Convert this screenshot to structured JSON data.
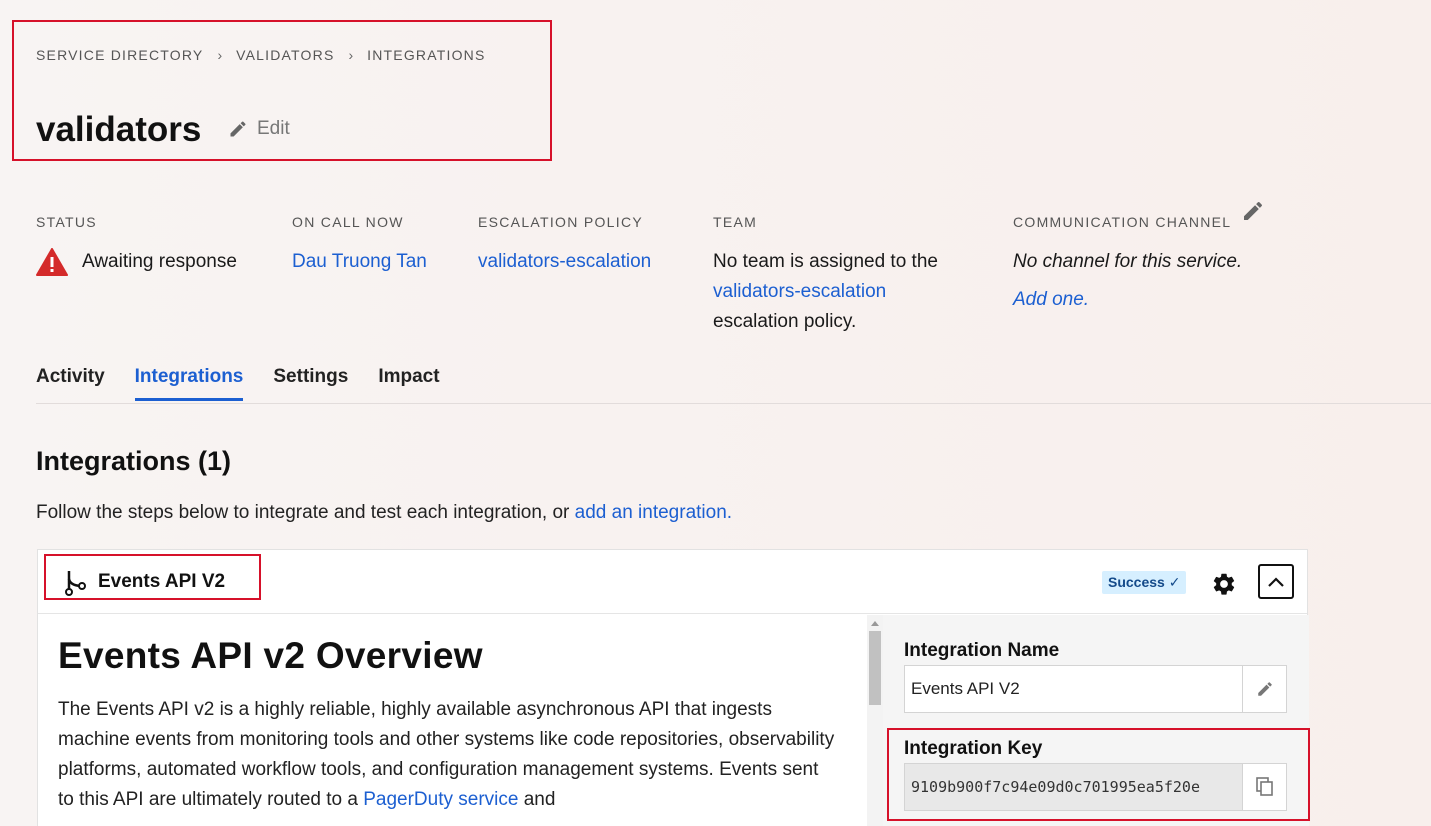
{
  "breadcrumb": {
    "items": [
      "SERVICE DIRECTORY",
      "VALIDATORS",
      "INTEGRATIONS"
    ],
    "separator": "›"
  },
  "page": {
    "title": "validators",
    "edit_label": "Edit"
  },
  "meta": {
    "status": {
      "label": "STATUS",
      "value": "Awaiting response",
      "icon": "warning-triangle-icon",
      "color": "#d42a2a"
    },
    "on_call": {
      "label": "ON CALL NOW",
      "value": "Dau Truong Tan"
    },
    "escalation": {
      "label": "ESCALATION POLICY",
      "value": "validators-escalation"
    },
    "team": {
      "label": "TEAM",
      "text_before": "No team is assigned to the",
      "link": "validators-escalation",
      "text_after": "escalation policy."
    },
    "channel": {
      "label": "COMMUNICATION CHANNEL",
      "empty_text": "No channel for this service.",
      "add_link": "Add one."
    }
  },
  "tabs": [
    {
      "label": "Activity",
      "active": false
    },
    {
      "label": "Integrations",
      "active": true
    },
    {
      "label": "Settings",
      "active": false
    },
    {
      "label": "Impact",
      "active": false
    }
  ],
  "integrations": {
    "title": "Integrations (1)",
    "intro_text": "Follow the steps below to integrate and test each integration, or",
    "intro_link": "add an integration."
  },
  "card": {
    "title": "Events API V2",
    "badge": "Success ✓",
    "doc_title": "Events API v2 Overview",
    "doc_body_before": "The Events API v2 is a highly reliable, highly available asynchronous API that ingests machine events from monitoring tools and other systems like code repositories, observability platforms, automated workflow tools, and configuration management systems. Events sent to this API are ultimately routed to a",
    "doc_body_link": "PagerDuty service",
    "doc_body_after": "and",
    "name_label": "Integration Name",
    "name_value": "Events API V2",
    "key_label": "Integration Key",
    "key_value": "9109b900f7c94e09d0c701995ea5f20e"
  },
  "colors": {
    "accent": "#1c5fd1",
    "highlight": "#d6112a",
    "success_bg": "#d6efff",
    "warning": "#d42a2a"
  }
}
